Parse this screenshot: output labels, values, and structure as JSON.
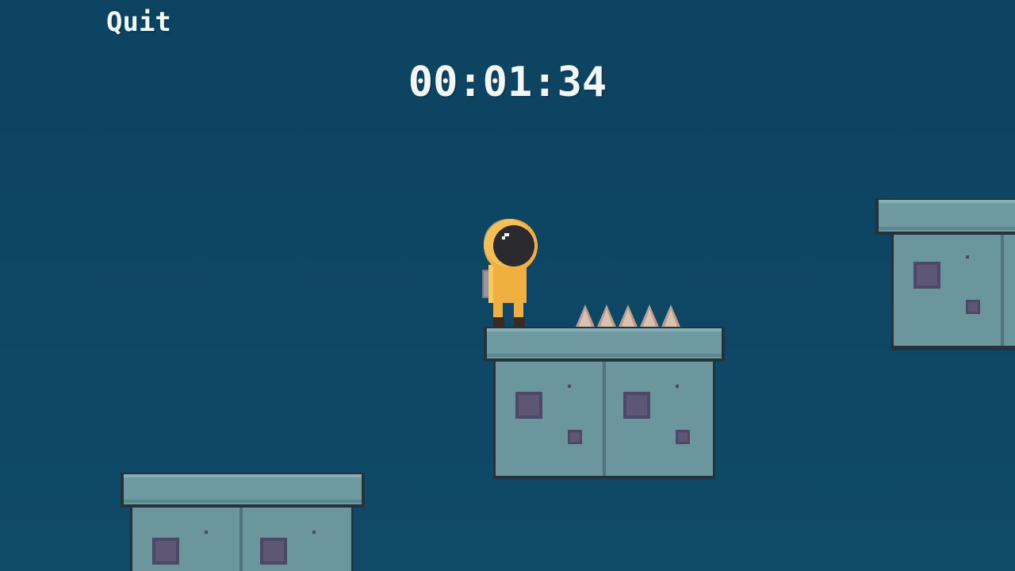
{
  "hud": {
    "quit_label": "Quit",
    "timer": "00:01:34"
  },
  "scene": {
    "player": "astronaut-player",
    "hazards": [
      "spike",
      "spike",
      "spike",
      "spike",
      "spike"
    ],
    "platforms": [
      "stone-platform",
      "stone-platform",
      "stone-platform"
    ]
  },
  "colors": {
    "background": "#0d4563",
    "platform_top": "#6f9aa1",
    "platform_body": "#6b969d",
    "platform_outline": "#23333c",
    "block_window": "#5e5773",
    "player_suit": "#f0b041",
    "player_visor": "#2b2b2f",
    "spike": "#dcc2ae"
  }
}
